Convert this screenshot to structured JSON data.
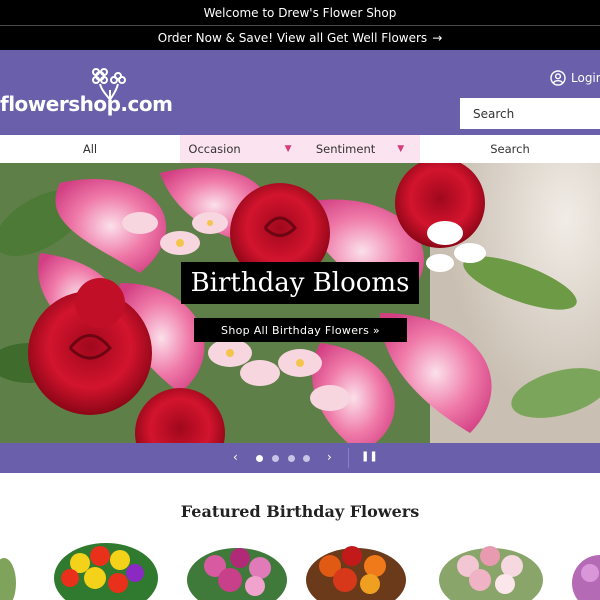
{
  "announcement": {
    "welcome": "Welcome to Drew's Flower Shop"
  },
  "promo": {
    "text": "Order Now & Save! View all Get Well Flowers",
    "arrow": "→"
  },
  "header": {
    "logo_text": "flowershop.com",
    "login_label": "Login",
    "search_placeholder": "Search",
    "brand_color": "#6a5faa"
  },
  "nav": {
    "items": [
      {
        "label": "All",
        "dropdown": false
      },
      {
        "label": "Occasion",
        "dropdown": true
      },
      {
        "label": "Sentiment",
        "dropdown": true
      },
      {
        "label": "Search",
        "dropdown": false
      }
    ],
    "highlight_color": "#fbe3ef"
  },
  "hero": {
    "title": "Birthday Blooms",
    "cta": "Shop All Birthday Flowers »"
  },
  "carousel": {
    "prev": "‹",
    "next": "›",
    "pause": "⏸",
    "slide_count": 4,
    "active_slide": 1
  },
  "featured": {
    "title": "Featured Birthday Flowers"
  }
}
